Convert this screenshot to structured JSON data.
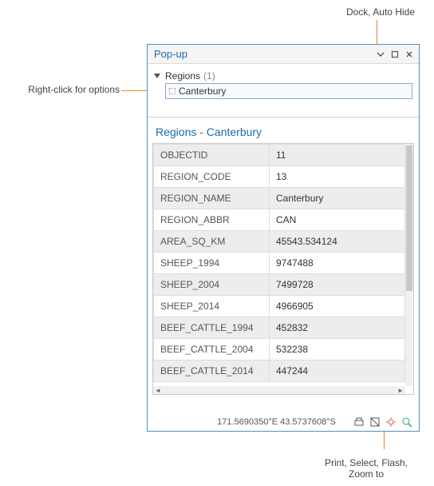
{
  "callouts": {
    "top": "Dock, Auto Hide",
    "left": "Right-click for options",
    "bottom_l1": "Print, Select, Flash,",
    "bottom_l2": "Zoom to"
  },
  "window": {
    "title": "Pop-up"
  },
  "tree": {
    "parent_label": "Regions",
    "count": "(1)",
    "child_label": "Canterbury"
  },
  "section_title": "Regions - Canterbury",
  "attrs": [
    {
      "k": "OBJECTID",
      "v": "11"
    },
    {
      "k": "REGION_CODE",
      "v": "13"
    },
    {
      "k": "REGION_NAME",
      "v": "Canterbury"
    },
    {
      "k": "REGION_ABBR",
      "v": "CAN"
    },
    {
      "k": "AREA_SQ_KM",
      "v": "45543.534124"
    },
    {
      "k": "SHEEP_1994",
      "v": "9747488"
    },
    {
      "k": "SHEEP_2004",
      "v": "7499728"
    },
    {
      "k": "SHEEP_2014",
      "v": "4966905"
    },
    {
      "k": "BEEF_CATTLE_1994",
      "v": "452832"
    },
    {
      "k": "BEEF_CATTLE_2004",
      "v": "532238"
    },
    {
      "k": "BEEF_CATTLE_2014",
      "v": "447244"
    }
  ],
  "status": {
    "coords": "171.5690350°E 43.5737608°S"
  }
}
